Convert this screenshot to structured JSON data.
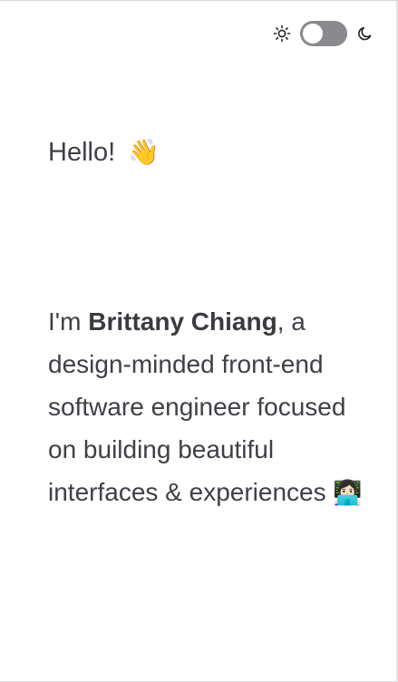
{
  "theme_toggle": {
    "light_icon": "sun-icon",
    "dark_icon": "moon-icon",
    "state": "light"
  },
  "hero": {
    "greeting": "Hello!",
    "greeting_emoji": "👋",
    "intro_prefix": "I'm ",
    "name": "Brittany Chiang",
    "intro_suffix": ", a design-minded front-end software engineer focused on building beautiful interfaces & experiences ",
    "intro_emoji": "👩🏻‍💻"
  },
  "colors": {
    "text": "#3f3f46",
    "toggle_track": "#8a8a8e",
    "toggle_knob": "#ffffff",
    "background": "#ffffff"
  }
}
